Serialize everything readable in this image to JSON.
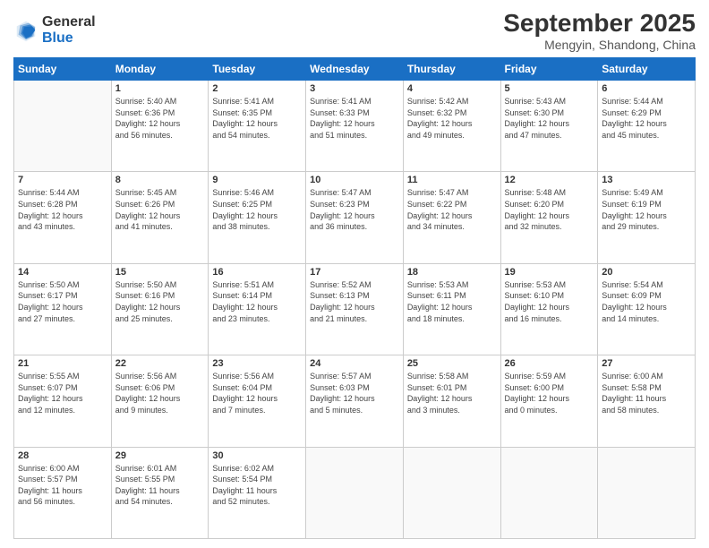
{
  "logo": {
    "general": "General",
    "blue": "Blue"
  },
  "header": {
    "month": "September 2025",
    "location": "Mengyin, Shandong, China"
  },
  "weekdays": [
    "Sunday",
    "Monday",
    "Tuesday",
    "Wednesday",
    "Thursday",
    "Friday",
    "Saturday"
  ],
  "weeks": [
    [
      {
        "day": "",
        "info": ""
      },
      {
        "day": "1",
        "info": "Sunrise: 5:40 AM\nSunset: 6:36 PM\nDaylight: 12 hours\nand 56 minutes."
      },
      {
        "day": "2",
        "info": "Sunrise: 5:41 AM\nSunset: 6:35 PM\nDaylight: 12 hours\nand 54 minutes."
      },
      {
        "day": "3",
        "info": "Sunrise: 5:41 AM\nSunset: 6:33 PM\nDaylight: 12 hours\nand 51 minutes."
      },
      {
        "day": "4",
        "info": "Sunrise: 5:42 AM\nSunset: 6:32 PM\nDaylight: 12 hours\nand 49 minutes."
      },
      {
        "day": "5",
        "info": "Sunrise: 5:43 AM\nSunset: 6:30 PM\nDaylight: 12 hours\nand 47 minutes."
      },
      {
        "day": "6",
        "info": "Sunrise: 5:44 AM\nSunset: 6:29 PM\nDaylight: 12 hours\nand 45 minutes."
      }
    ],
    [
      {
        "day": "7",
        "info": "Sunrise: 5:44 AM\nSunset: 6:28 PM\nDaylight: 12 hours\nand 43 minutes."
      },
      {
        "day": "8",
        "info": "Sunrise: 5:45 AM\nSunset: 6:26 PM\nDaylight: 12 hours\nand 41 minutes."
      },
      {
        "day": "9",
        "info": "Sunrise: 5:46 AM\nSunset: 6:25 PM\nDaylight: 12 hours\nand 38 minutes."
      },
      {
        "day": "10",
        "info": "Sunrise: 5:47 AM\nSunset: 6:23 PM\nDaylight: 12 hours\nand 36 minutes."
      },
      {
        "day": "11",
        "info": "Sunrise: 5:47 AM\nSunset: 6:22 PM\nDaylight: 12 hours\nand 34 minutes."
      },
      {
        "day": "12",
        "info": "Sunrise: 5:48 AM\nSunset: 6:20 PM\nDaylight: 12 hours\nand 32 minutes."
      },
      {
        "day": "13",
        "info": "Sunrise: 5:49 AM\nSunset: 6:19 PM\nDaylight: 12 hours\nand 29 minutes."
      }
    ],
    [
      {
        "day": "14",
        "info": "Sunrise: 5:50 AM\nSunset: 6:17 PM\nDaylight: 12 hours\nand 27 minutes."
      },
      {
        "day": "15",
        "info": "Sunrise: 5:50 AM\nSunset: 6:16 PM\nDaylight: 12 hours\nand 25 minutes."
      },
      {
        "day": "16",
        "info": "Sunrise: 5:51 AM\nSunset: 6:14 PM\nDaylight: 12 hours\nand 23 minutes."
      },
      {
        "day": "17",
        "info": "Sunrise: 5:52 AM\nSunset: 6:13 PM\nDaylight: 12 hours\nand 21 minutes."
      },
      {
        "day": "18",
        "info": "Sunrise: 5:53 AM\nSunset: 6:11 PM\nDaylight: 12 hours\nand 18 minutes."
      },
      {
        "day": "19",
        "info": "Sunrise: 5:53 AM\nSunset: 6:10 PM\nDaylight: 12 hours\nand 16 minutes."
      },
      {
        "day": "20",
        "info": "Sunrise: 5:54 AM\nSunset: 6:09 PM\nDaylight: 12 hours\nand 14 minutes."
      }
    ],
    [
      {
        "day": "21",
        "info": "Sunrise: 5:55 AM\nSunset: 6:07 PM\nDaylight: 12 hours\nand 12 minutes."
      },
      {
        "day": "22",
        "info": "Sunrise: 5:56 AM\nSunset: 6:06 PM\nDaylight: 12 hours\nand 9 minutes."
      },
      {
        "day": "23",
        "info": "Sunrise: 5:56 AM\nSunset: 6:04 PM\nDaylight: 12 hours\nand 7 minutes."
      },
      {
        "day": "24",
        "info": "Sunrise: 5:57 AM\nSunset: 6:03 PM\nDaylight: 12 hours\nand 5 minutes."
      },
      {
        "day": "25",
        "info": "Sunrise: 5:58 AM\nSunset: 6:01 PM\nDaylight: 12 hours\nand 3 minutes."
      },
      {
        "day": "26",
        "info": "Sunrise: 5:59 AM\nSunset: 6:00 PM\nDaylight: 12 hours\nand 0 minutes."
      },
      {
        "day": "27",
        "info": "Sunrise: 6:00 AM\nSunset: 5:58 PM\nDaylight: 11 hours\nand 58 minutes."
      }
    ],
    [
      {
        "day": "28",
        "info": "Sunrise: 6:00 AM\nSunset: 5:57 PM\nDaylight: 11 hours\nand 56 minutes."
      },
      {
        "day": "29",
        "info": "Sunrise: 6:01 AM\nSunset: 5:55 PM\nDaylight: 11 hours\nand 54 minutes."
      },
      {
        "day": "30",
        "info": "Sunrise: 6:02 AM\nSunset: 5:54 PM\nDaylight: 11 hours\nand 52 minutes."
      },
      {
        "day": "",
        "info": ""
      },
      {
        "day": "",
        "info": ""
      },
      {
        "day": "",
        "info": ""
      },
      {
        "day": "",
        "info": ""
      }
    ]
  ]
}
